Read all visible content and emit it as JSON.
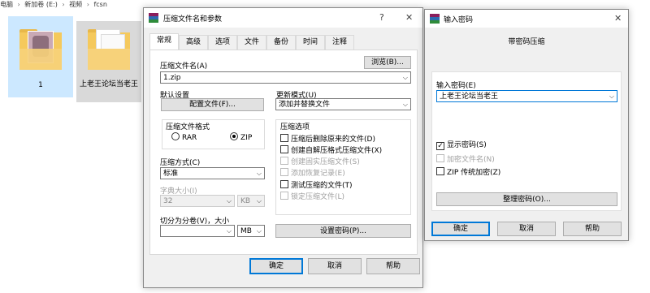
{
  "explorer": {
    "breadcrumb": [
      "电脑",
      "新加卷 (E:)",
      "视频",
      "fcsn"
    ],
    "items": [
      {
        "label": "1"
      },
      {
        "label": "上老王论坛当老王"
      }
    ]
  },
  "archive_dialog": {
    "title": "压缩文件名和参数",
    "help_glyph": "?",
    "close_glyph": "✕",
    "tabs": [
      "常规",
      "高级",
      "选项",
      "文件",
      "备份",
      "时间",
      "注释"
    ],
    "filename_label": "压缩文件名(A)",
    "filename_value": "1.zip",
    "browse_button": "浏览(B)...",
    "default_settings_label": "默认设置",
    "profiles_button": "配置文件(F)...",
    "update_mode_label": "更新模式(U)",
    "update_mode_value": "添加并替换文件",
    "format_group_label": "压缩文件格式",
    "format_rar": "RAR",
    "format_zip": "ZIP",
    "selected_format": "ZIP",
    "method_label": "压缩方式(C)",
    "method_value": "标准",
    "dict_label": "字典大小(I)",
    "dict_value": "32",
    "dict_unit": "KB",
    "split_label": "切分为分卷(V)，大小",
    "split_value": "",
    "split_unit": "MB",
    "options_group_label": "压缩选项",
    "options": [
      {
        "label": "压缩后删除原来的文件(D)",
        "checked": false,
        "disabled": false
      },
      {
        "label": "创建自解压格式压缩文件(X)",
        "checked": false,
        "disabled": false
      },
      {
        "label": "创建固实压缩文件(S)",
        "checked": false,
        "disabled": true
      },
      {
        "label": "添加恢复记录(E)",
        "checked": false,
        "disabled": true
      },
      {
        "label": "测试压缩的文件(T)",
        "checked": false,
        "disabled": false
      },
      {
        "label": "锁定压缩文件(L)",
        "checked": false,
        "disabled": true
      }
    ],
    "set_password_button": "设置密码(P)...",
    "ok_button": "确定",
    "cancel_button": "取消",
    "help_button": "帮助"
  },
  "password_dialog": {
    "title": "输入密码",
    "close_glyph": "✕",
    "heading": "带密码压缩",
    "password_label": "输入密码(E)",
    "password_value": "上老王论坛当老王",
    "show_password": {
      "label": "显示密码(S)",
      "checked": true
    },
    "encrypt_names": {
      "label": "加密文件名(N)",
      "checked": false,
      "disabled": true
    },
    "zip_legacy": {
      "label": "ZIP 传统加密(Z)",
      "checked": false
    },
    "organize_button": "整理密码(O)...",
    "ok_button": "确定",
    "cancel_button": "取消",
    "help_button": "帮助"
  },
  "colors": {
    "accent": "#0078d7",
    "dialog_bg": "#f0f0f0",
    "selected_item": "#cce8ff"
  }
}
